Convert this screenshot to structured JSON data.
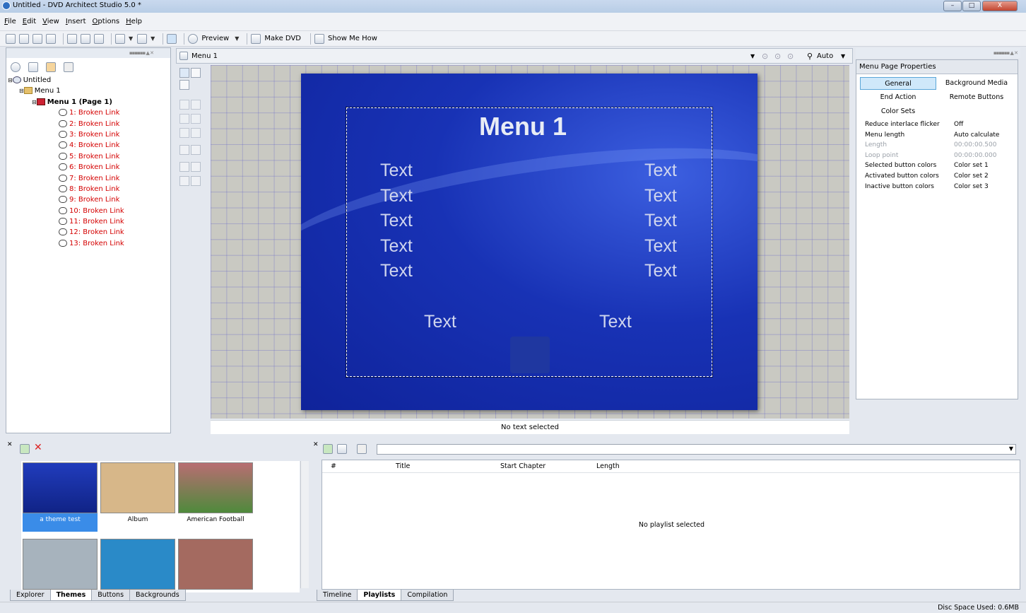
{
  "window": {
    "title": "Untitled - DVD Architect Studio 5.0 *",
    "min": "–",
    "max": "□",
    "close": "X"
  },
  "menubar": [
    "File",
    "Edit",
    "View",
    "Insert",
    "Options",
    "Help"
  ],
  "toolbar": {
    "preview": "Preview",
    "make_dvd": "Make DVD",
    "show_me_how": "Show Me How"
  },
  "tree": {
    "root": "Untitled",
    "menu": "Menu 1",
    "page": "Menu 1 (Page 1)",
    "links": [
      "1: Broken Link",
      "2: Broken Link",
      "3: Broken Link",
      "4: Broken Link",
      "5: Broken Link",
      "6: Broken Link",
      "7: Broken Link",
      "8: Broken Link",
      "9: Broken Link",
      "10: Broken Link",
      "11: Broken Link",
      "12: Broken Link",
      "13: Broken Link"
    ]
  },
  "editor": {
    "tab_label": "Menu 1",
    "zoom": "Auto",
    "menu_title": "Menu 1",
    "button_text": "Text",
    "status": "No text selected"
  },
  "properties": {
    "header": "Menu Page Properties",
    "tabs": [
      "General",
      "Background Media",
      "End Action",
      "Remote Buttons",
      "Color Sets"
    ],
    "rows": [
      {
        "k": "Reduce interlace flicker",
        "v": "Off"
      },
      {
        "k": "Menu length",
        "v": "Auto calculate"
      },
      {
        "k": "Length",
        "v": "00:00:00.500"
      },
      {
        "k": "Loop point",
        "v": "00:00:00.000"
      },
      {
        "k": "Selected button colors",
        "v": "Color set 1"
      },
      {
        "k": "Activated button colors",
        "v": "Color set 2"
      },
      {
        "k": "Inactive button colors",
        "v": "Color set 3"
      }
    ]
  },
  "themes": {
    "items": [
      "a theme test",
      "Album",
      "American Football",
      "",
      "",
      ""
    ],
    "tabs": [
      "Explorer",
      "Themes",
      "Buttons",
      "Backgrounds"
    ]
  },
  "playlist": {
    "columns": [
      "#",
      "Title",
      "Start Chapter",
      "Length"
    ],
    "empty": "No playlist selected",
    "tabs": [
      "Timeline",
      "Playlists",
      "Compilation"
    ]
  },
  "status": {
    "disc_space": "Disc Space Used: 0.6MB"
  },
  "colors": {
    "accent": "#3a8ce8",
    "menu_bg": "#1832b5",
    "broken_link": "#d40000"
  }
}
